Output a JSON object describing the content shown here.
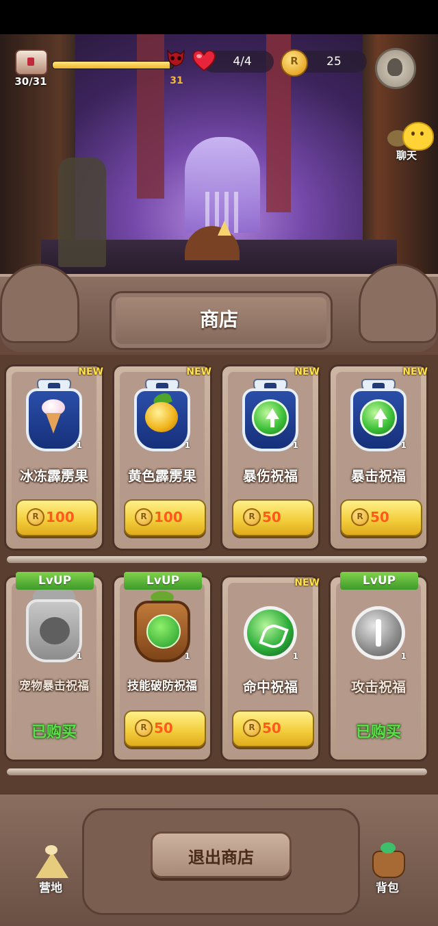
{
  "hud": {
    "chest_count": "30/31",
    "xp_progress": 0.97,
    "boss_level": "31",
    "hp": "4/4",
    "coins": "25",
    "chat_label": "聊天"
  },
  "shop": {
    "title": "商店",
    "items": [
      {
        "name": "冰冻霹雳果",
        "badge": "NEW",
        "price": "100",
        "count": "1"
      },
      {
        "name": "黄色霹雳果",
        "badge": "NEW",
        "price": "100",
        "count": "1"
      },
      {
        "name": "暴伤祝福",
        "badge": "NEW",
        "price": "50",
        "count": "1"
      },
      {
        "name": "暴击祝福",
        "badge": "NEW",
        "price": "50",
        "count": "1"
      },
      {
        "name": "宠物暴击祝福",
        "badge": "LvUP",
        "status": "已购买",
        "count": "1"
      },
      {
        "name": "技能破防祝福",
        "badge": "LvUP",
        "price": "50",
        "count": "1"
      },
      {
        "name": "命中祝福",
        "badge": "NEW",
        "price": "50",
        "count": "1"
      },
      {
        "name": "攻击祝福",
        "badge": "LvUP",
        "status": "已购买",
        "count": "1"
      }
    ],
    "exit_label": "退出商店"
  },
  "nav": {
    "camp_label": "营地",
    "bag_label": "背包"
  },
  "colors": {
    "price_text": "#ff5a1e",
    "bought_text": "#5be04a",
    "new_badge": "#ffe14a",
    "lvup_badge": "#4fa82e"
  }
}
